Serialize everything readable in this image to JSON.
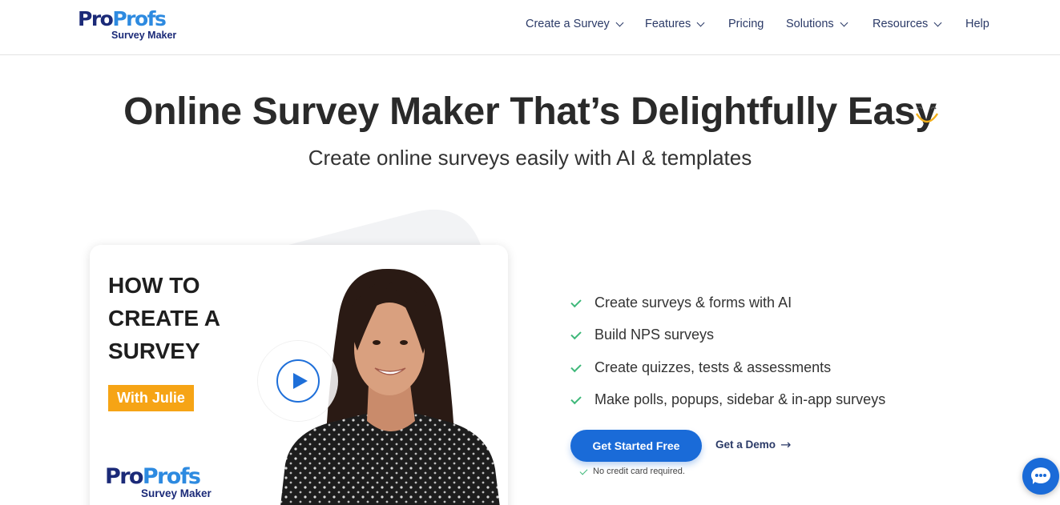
{
  "header": {
    "logo_pro": "Pro",
    "logo_profs": "Profs",
    "logo_sub": "Survey Maker",
    "nav": [
      {
        "label": "Create a Survey",
        "dropdown": true
      },
      {
        "label": "Features",
        "dropdown": true
      },
      {
        "label": "Pricing",
        "dropdown": false
      },
      {
        "label": "Solutions",
        "dropdown": true
      },
      {
        "label": "Resources",
        "dropdown": true
      },
      {
        "label": "Help",
        "dropdown": false
      }
    ]
  },
  "hero": {
    "title": "Online Survey Maker That’s Delightfully Easy",
    "subtitle": "Create online surveys easily with AI & templates"
  },
  "video_card": {
    "title": "HOW TO CREATE A SURVEY",
    "badge": "With Julie",
    "logo_pro": "Pro",
    "logo_profs": "Profs",
    "logo_sub": "Survey Maker",
    "play_icon": "play-icon"
  },
  "features": [
    "Create surveys & forms with AI",
    "Build NPS surveys",
    "Create quizzes, tests & assessments",
    "Make polls, popups, sidebar & in-app surveys"
  ],
  "cta": {
    "primary_label": "Get Started Free",
    "secondary_label": "Get a Demo",
    "note": "No credit card required."
  },
  "colors": {
    "brand_dark": "#1b2a78",
    "brand_blue": "#2d8ae0",
    "button_blue": "#1a6bd8",
    "check_green": "#3fb87a",
    "badge_orange": "#f6a415"
  },
  "chat": {
    "icon": "chat-bubble-icon"
  }
}
